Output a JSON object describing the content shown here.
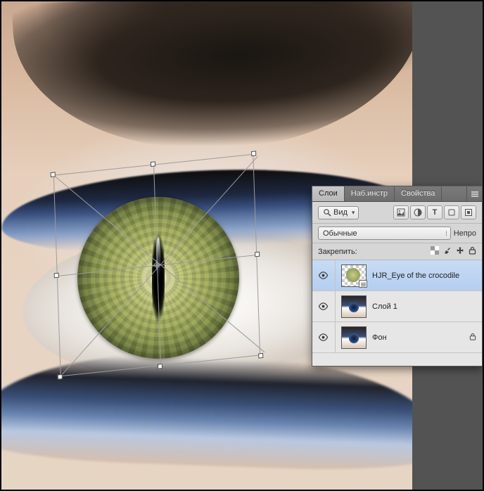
{
  "panel": {
    "tabs": {
      "layers": "Слои",
      "presets": "Наб.инстр",
      "props": "Свойства"
    },
    "filter_label": "Вид",
    "blend_mode": "Обычные",
    "opacity_label": "Непро",
    "lock_label": "Закрепить:"
  },
  "layers": [
    {
      "name": "HJR_Eye of the crocodile"
    },
    {
      "name": "Слой 1"
    },
    {
      "name": "Фон"
    }
  ]
}
